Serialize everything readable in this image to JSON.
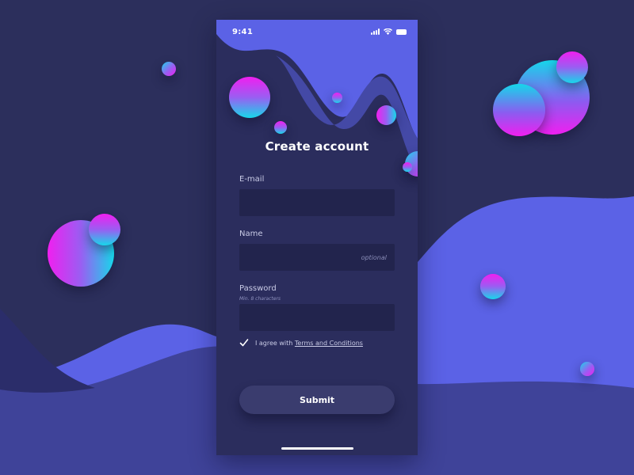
{
  "colors": {
    "background": "#2c2f5c",
    "wave_light": "#5b62e6",
    "wave_mid": "#4c52b8",
    "wave_dark": "#3b3f8e",
    "card": "#2b2d5d",
    "input": "#22244d",
    "button": "#3a3c6e",
    "gradient_pink": "#f01ff0",
    "gradient_cyan": "#16d8ea"
  },
  "status_bar": {
    "time": "9:41",
    "icons": [
      "signal-icon",
      "wifi-icon",
      "battery-icon"
    ]
  },
  "form": {
    "title": "Create account",
    "email": {
      "label": "E-mail",
      "value": "",
      "placeholder": ""
    },
    "name": {
      "label": "Name",
      "value": "",
      "placeholder": "optional"
    },
    "password": {
      "label": "Password",
      "hint": "Min. 8 characters",
      "value": "",
      "placeholder": ""
    },
    "agree": {
      "checked": true,
      "text": "I agree with",
      "link": "Terms and Conditions"
    },
    "submit_label": "Submit"
  }
}
